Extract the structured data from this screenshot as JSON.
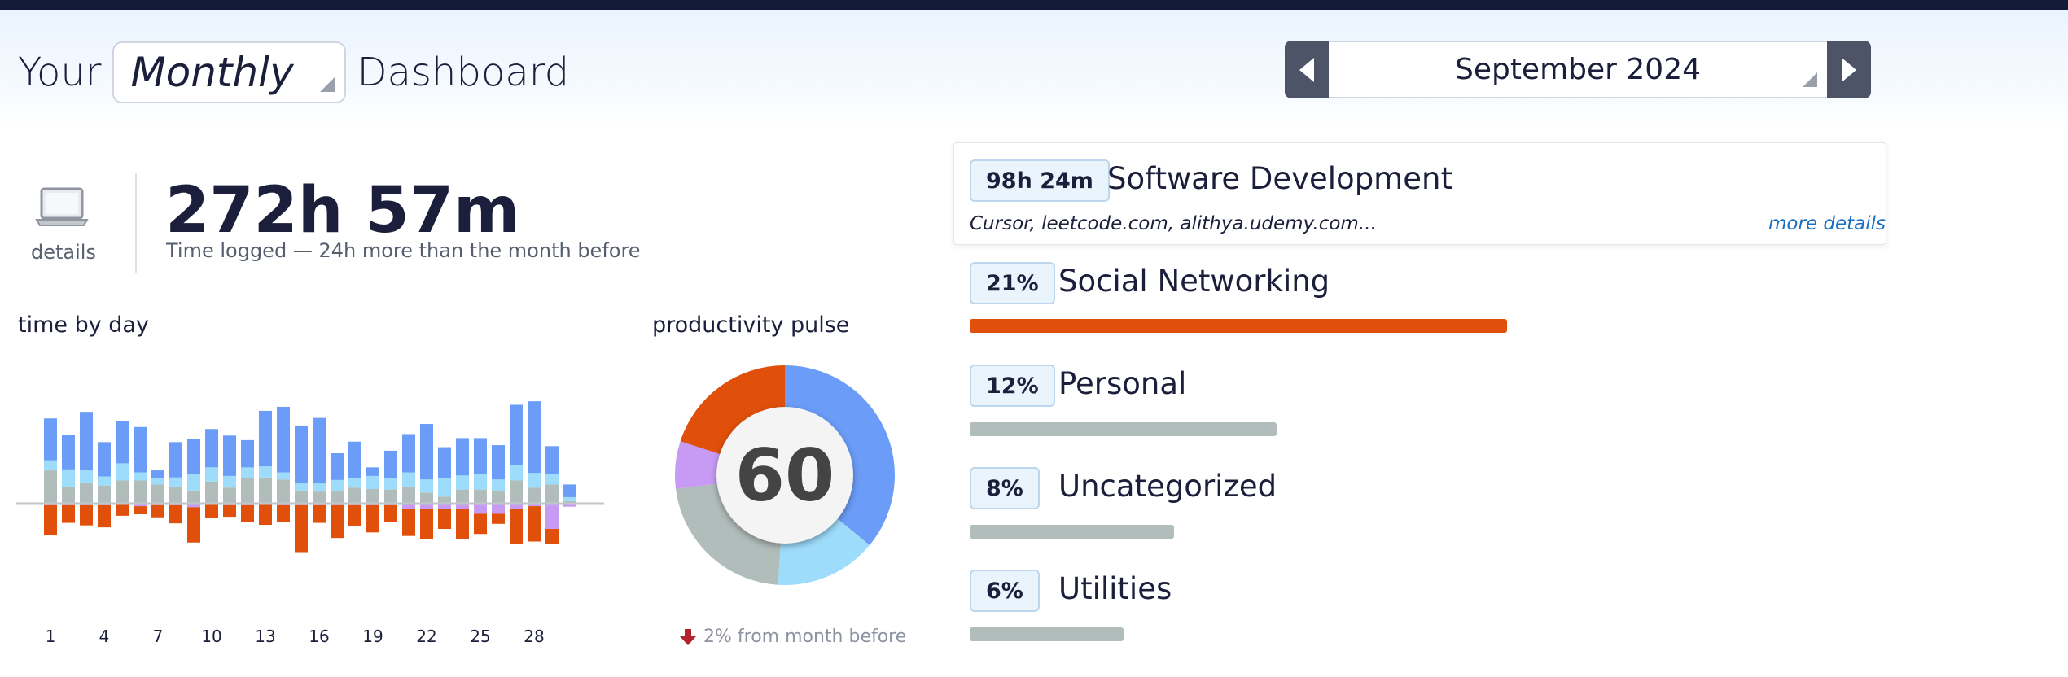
{
  "header": {
    "title_prefix": "Your",
    "period_value": "Monthly",
    "title_suffix": "Dashboard",
    "month_label": "September 2024"
  },
  "summary": {
    "details_label": "details",
    "total_time": "272h 57m",
    "subtitle": "Time logged — 24h more than the month before"
  },
  "time_by_day": {
    "label": "time by day"
  },
  "productivity_pulse": {
    "label": "productivity pulse",
    "score": "60",
    "delta_text": "2% from month before"
  },
  "categories": [
    {
      "badge": "98h 24m",
      "name": "Software Development",
      "apps": "Cursor, leetcode.com, alithya.udemy.com...",
      "more": "more details",
      "fraction": 1.0,
      "color": "#2f6fe0"
    },
    {
      "badge": "21%",
      "name": "Social Networking",
      "fraction": 0.21,
      "color": "#e0500a"
    },
    {
      "badge": "12%",
      "name": "Personal",
      "fraction": 0.12,
      "color": "#b1bdbb"
    },
    {
      "badge": "8%",
      "name": "Uncategorized",
      "fraction": 0.08,
      "color": "#b1bdbb"
    },
    {
      "badge": "6%",
      "name": "Utilities",
      "fraction": 0.06,
      "color": "#b1bdbb"
    }
  ],
  "colors": {
    "very_productive": "#6b9cf7",
    "productive": "#9ddcfb",
    "neutral": "#b1bdbb",
    "distracting": "#c79af4",
    "very_distracting": "#e0500a",
    "nav_button": "#4d5467"
  },
  "chart_data": [
    {
      "type": "bar",
      "title": "time by day",
      "x_tick_labels": [
        "1",
        "4",
        "7",
        "10",
        "13",
        "16",
        "19",
        "22",
        "25",
        "28"
      ],
      "categories": [
        1,
        2,
        3,
        4,
        5,
        6,
        7,
        8,
        9,
        10,
        11,
        12,
        13,
        14,
        15,
        16,
        17,
        18,
        19,
        20,
        21,
        22,
        23,
        24,
        25,
        26,
        27,
        28,
        29,
        30
      ],
      "stacked": true,
      "diverging": true,
      "grid": false,
      "series": [
        {
          "key": "neutral",
          "direction": "up",
          "values": [
            6.6,
            3.4,
            4.2,
            3.6,
            4.6,
            4.6,
            3.8,
            3.4,
            2.6,
            4.4,
            3.2,
            5.0,
            5.2,
            4.8,
            2.6,
            2.4,
            2.5,
            3.2,
            2.9,
            2.8,
            3.4,
            2.2,
            1.4,
            2.8,
            2.8,
            2.5,
            4.6,
            3.2,
            3.8,
            0.5
          ]
        },
        {
          "key": "productive",
          "direction": "up",
          "values": [
            2.0,
            3.4,
            2.4,
            1.8,
            3.4,
            1.6,
            1.2,
            1.8,
            3.2,
            2.8,
            2.3,
            2.2,
            2.2,
            1.4,
            1.4,
            1.6,
            2.2,
            1.9,
            2.6,
            2.3,
            2.8,
            2.6,
            3.6,
            2.8,
            3.0,
            2.3,
            3.0,
            2.9,
            2.0,
            0.8
          ]
        },
        {
          "key": "very_productive",
          "direction": "up",
          "values": [
            8.3,
            6.8,
            11.6,
            6.8,
            8.3,
            9.0,
            1.6,
            7.0,
            7.0,
            7.6,
            8.0,
            5.4,
            11.0,
            13.0,
            11.5,
            13.0,
            5.3,
            7.2,
            1.7,
            5.4,
            7.6,
            11.0,
            6.2,
            7.4,
            7.2,
            6.8,
            12.0,
            14.2,
            5.6,
            2.5
          ]
        },
        {
          "key": "distracting",
          "direction": "down",
          "values": [
            0.3,
            0.3,
            0.3,
            0.3,
            0.2,
            0.5,
            0.3,
            0.3,
            0.7,
            0.2,
            0.3,
            0.3,
            0.2,
            0.3,
            0.3,
            0.3,
            0.3,
            0.3,
            0.3,
            0.3,
            1.0,
            1.0,
            1.0,
            1.0,
            2.0,
            2.0,
            1.0,
            0.5,
            5.0,
            0.6
          ]
        },
        {
          "key": "very_distracting",
          "direction": "down",
          "values": [
            6.0,
            3.5,
            4.0,
            4.4,
            2.2,
            1.6,
            2.4,
            3.6,
            7.0,
            2.7,
            2.3,
            3.3,
            4.0,
            3.3,
            9.3,
            3.5,
            6.5,
            4.2,
            5.4,
            3.4,
            5.4,
            6.0,
            4.0,
            6.0,
            4.0,
            2.0,
            7.0,
            7.0,
            3.0,
            0
          ]
        }
      ]
    },
    {
      "type": "pie",
      "title": "productivity pulse",
      "donut": true,
      "center_value": 60,
      "slices": [
        {
          "key": "very_productive",
          "value": 36
        },
        {
          "key": "productive",
          "value": 15
        },
        {
          "key": "neutral",
          "value": 22
        },
        {
          "key": "distracting",
          "value": 7
        },
        {
          "key": "very_distracting",
          "value": 20
        }
      ]
    }
  ]
}
